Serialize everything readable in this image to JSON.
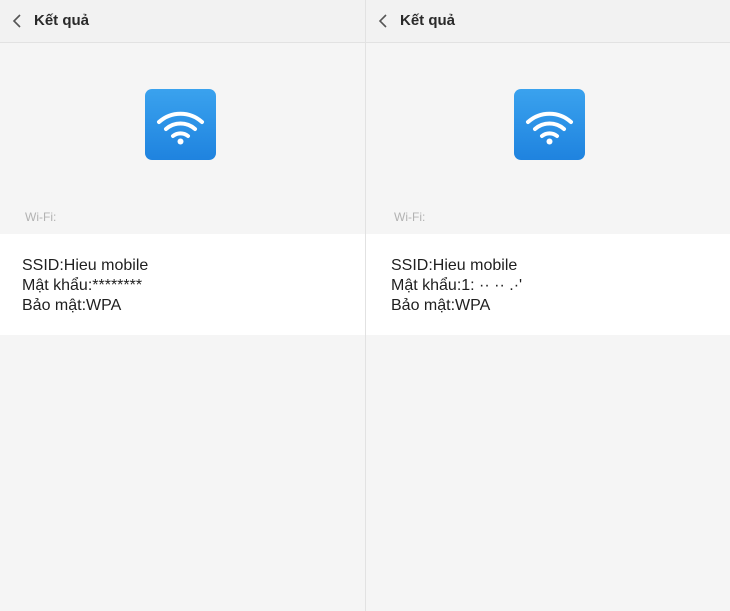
{
  "screens": [
    {
      "header_title": "Kết quả",
      "section_label": "Wi-Fi:",
      "ssid_line": "SSID:Hieu mobile",
      "password_line": "Mật khẩu:********",
      "security_line": "Bảo mật:WPA"
    },
    {
      "header_title": "Kết quả",
      "section_label": "Wi-Fi:",
      "ssid_line": "SSID:Hieu mobile",
      "password_line": "Mật khẩu:1: ·· ·· .·'",
      "security_line": "Bảo mật:WPA"
    }
  ],
  "icons": {
    "back": "chevron-left-icon",
    "wifi": "wifi-icon"
  },
  "colors": {
    "wifi_tile": "#2b95e8",
    "background": "#f5f5f5",
    "card": "#ffffff"
  }
}
